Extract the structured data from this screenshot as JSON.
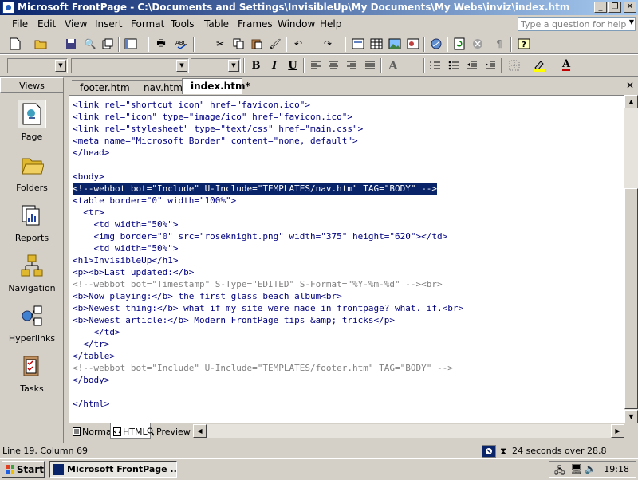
{
  "window": {
    "title": "Microsoft FrontPage - C:\\Documents and Settings\\InvisibleUp\\My Documents\\My Webs\\inviz\\index.htm"
  },
  "menu": {
    "items": [
      "File",
      "Edit",
      "View",
      "Insert",
      "Format",
      "Tools",
      "Table",
      "Frames",
      "Window",
      "Help"
    ],
    "ask_placeholder": "Type a question for help"
  },
  "format_bar": {
    "bold": "B",
    "italic": "I",
    "underline": "U",
    "grow_font": "A",
    "font_color": "A"
  },
  "views": {
    "header": "Views",
    "items": [
      "Page",
      "Folders",
      "Reports",
      "Navigation",
      "Hyperlinks",
      "Tasks"
    ],
    "active": "Page"
  },
  "tabs": {
    "items": [
      "footer.htm",
      "nav.htm",
      "index.htm*"
    ],
    "active": "index.htm*"
  },
  "editor": {
    "lines": [
      "<link rel=\"shortcut icon\" href=\"favicon.ico\">",
      "<link rel=\"icon\" type=\"image/ico\" href=\"favicon.ico\">",
      "<link rel=\"stylesheet\" type=\"text/css\" href=\"main.css\">",
      "<meta name=\"Microsoft Border\" content=\"none, default\">",
      "</head>",
      "",
      "<body>",
      "<!--webbot bot=\"Include\" U-Include=\"TEMPLATES/nav.htm\" TAG=\"BODY\" -->",
      "<table border=\"0\" width=\"100%\">",
      "  <tr>",
      "    <td width=\"50%\">",
      "    <img border=\"0\" src=\"roseknight.png\" width=\"375\" height=\"620\"></td>",
      "    <td width=\"50%\">",
      "<h1>InvisibleUp</h1>",
      "<p><b>Last updated:</b>",
      "<!--webbot bot=\"Timestamp\" S-Type=\"EDITED\" S-Format=\"%Y-%m-%d\" --><br>",
      "<b>Now playing:</b> the first glass beach album<br>",
      "<b>Newest thing:</b> what if my site were made in frontpage? what. if.<br>",
      "<b>Newest article:</b> Modern FrontPage tips &amp; tricks</p>",
      "    </td>",
      "  </tr>",
      "</table>",
      "<!--webbot bot=\"Include\" U-Include=\"TEMPLATES/footer.htm\" TAG=\"BODY\" -->",
      "</body>",
      "",
      "</html>"
    ],
    "selected_line": 7
  },
  "view_tabs": {
    "items": [
      "Normal",
      "HTML",
      "Preview"
    ],
    "active": "HTML"
  },
  "status": {
    "position": "Line 19, Column 69",
    "download_time": "24 seconds over 28.8"
  },
  "taskbar": {
    "start": "Start",
    "task": "Microsoft FrontPage ...",
    "clock": "19:18"
  }
}
